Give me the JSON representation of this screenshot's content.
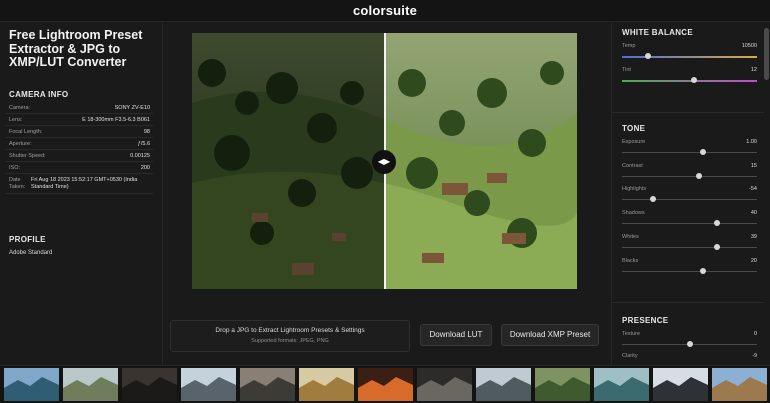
{
  "brand": "colorsuite",
  "left": {
    "title": "Free Lightroom Preset Extractor & JPG to XMP/LUT Converter",
    "camera_info": {
      "heading": "CAMERA INFO",
      "rows": [
        {
          "key": "Camera:",
          "value": "SONY ZV-E10"
        },
        {
          "key": "Lens:",
          "value": "E 18-300mm F3.5-6.3 B061"
        },
        {
          "key": "Focal Length:",
          "value": "98"
        },
        {
          "key": "Aperture:",
          "value": "ƒ/5.6"
        },
        {
          "key": "Shutter Speed:",
          "value": "0.00125"
        },
        {
          "key": "ISO:",
          "value": "200"
        },
        {
          "key": "Date Taken:",
          "value": "Fri Aug 18 2023 15:52:17 GMT+0530 (India Standard Time)"
        }
      ]
    },
    "profile": {
      "heading": "PROFILE",
      "value": "Adobe Standard"
    }
  },
  "center": {
    "handle_glyph": "◀▶",
    "dropzone": {
      "main": "Drop a JPG to Extract Lightroom Presets & Settings",
      "sub": "Supported formats: JPEG, PNG"
    },
    "download_lut": "Download LUT",
    "download_xmp": "Download XMP Preset"
  },
  "right": {
    "white_balance": {
      "heading": "WHITE BALANCE",
      "sliders": [
        {
          "label": "Temp",
          "value": "10500",
          "position": 0.19,
          "track": "temp"
        },
        {
          "label": "Tint",
          "value": "12",
          "position": 0.53,
          "track": "tint"
        }
      ]
    },
    "tone": {
      "heading": "TONE",
      "sliders": [
        {
          "label": "Exposure",
          "value": "1.00",
          "position": 0.6
        },
        {
          "label": "Contrast",
          "value": "15",
          "position": 0.57
        },
        {
          "label": "Highlights",
          "value": "-54",
          "position": 0.23
        },
        {
          "label": "Shadows",
          "value": "40",
          "position": 0.7
        },
        {
          "label": "Whites",
          "value": "39",
          "position": 0.7
        },
        {
          "label": "Blacks",
          "value": "20",
          "position": 0.6
        }
      ]
    },
    "presence": {
      "heading": "PRESENCE",
      "sliders": [
        {
          "label": "Texture",
          "value": "0",
          "position": 0.5
        },
        {
          "label": "Clarity",
          "value": "-9",
          "position": 0.46
        }
      ]
    }
  },
  "colors": {
    "temp_gradient": [
      "#4d6fd8",
      "#e0a840"
    ],
    "tint_gradient": [
      "#4caf50",
      "#c04bd0"
    ],
    "background": "#1a1a1a",
    "panel": "#141414"
  },
  "thumbnails": [
    {
      "name": "alpine-lake",
      "sky": "#7fa7c9",
      "land": "#2f5d74"
    },
    {
      "name": "mountain-valley",
      "sky": "#b9c7c9",
      "land": "#6e7d5c"
    },
    {
      "name": "dark-peak-sunset",
      "sky": "#3a3431",
      "land": "#1c1a19"
    },
    {
      "name": "snowy-ridge",
      "sky": "#c4d2dc",
      "land": "#59636b"
    },
    {
      "name": "dusk-hills",
      "sky": "#8a7f74",
      "land": "#3d3b35"
    },
    {
      "name": "golden-field",
      "sky": "#d7c9a1",
      "land": "#a07d3e"
    },
    {
      "name": "city-lights",
      "sky": "#3b1f14",
      "land": "#d86a2a"
    },
    {
      "name": "lemur",
      "sky": "#2c2b29",
      "land": "#6a6660"
    },
    {
      "name": "misty-range",
      "sky": "#bfcad3",
      "land": "#4f5b5e"
    },
    {
      "name": "green-village",
      "sky": "#7e9262",
      "land": "#3e5a2e"
    },
    {
      "name": "lake-cabin",
      "sky": "#9fbfc6",
      "land": "#3b6b6e"
    },
    {
      "name": "snow-town",
      "sky": "#d6dde3",
      "land": "#2e3236"
    },
    {
      "name": "highland-cow",
      "sky": "#8bb0d4",
      "land": "#9c7a4d"
    }
  ]
}
